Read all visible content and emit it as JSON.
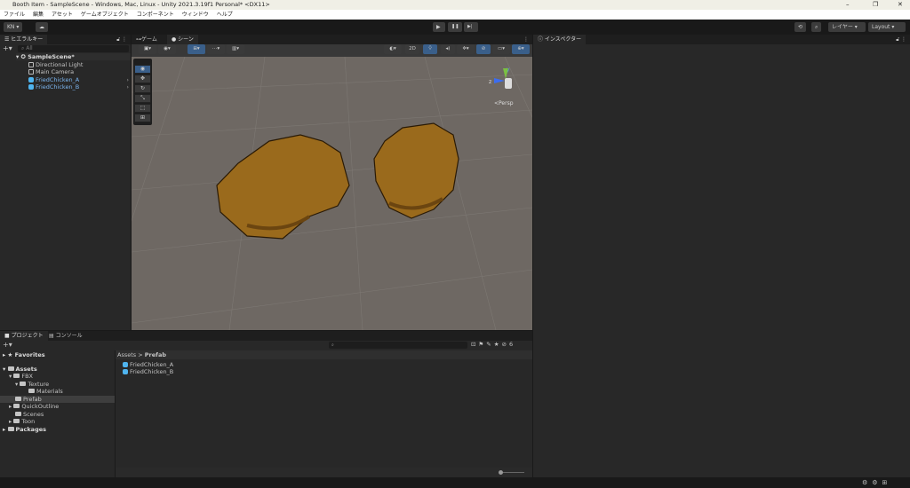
{
  "window": {
    "title": "Booth Item - SampleScene - Windows, Mac, Linux - Unity 2021.3.19f1 Personal* <DX11>",
    "minimize": "–",
    "maximize": "❐",
    "close": "✕"
  },
  "menu": [
    "ファイル",
    "編集",
    "アセット",
    "ゲームオブジェクト",
    "コンポーネント",
    "ウィンドウ",
    "ヘルプ"
  ],
  "toolbar": {
    "account": "KN ▾",
    "cloud": "☁",
    "play": "▶",
    "pause": "❚❚",
    "step": "▶|",
    "history": "⟲",
    "search": "⌕",
    "layers": "レイヤー",
    "layout": "Layout"
  },
  "hierarchy": {
    "tab": "ヒエラルキー",
    "search_placeholder": "All",
    "add": "+▾",
    "scene": "SampleScene*",
    "items": [
      {
        "label": "Directional Light",
        "prefab": false
      },
      {
        "label": "Main Camera",
        "prefab": false
      },
      {
        "label": "FriedChicken_A",
        "prefab": true
      },
      {
        "label": "FriedChicken_B",
        "prefab": true
      }
    ]
  },
  "scene_view": {
    "tabs": [
      "ゲーム",
      "シーン"
    ],
    "active_tab": "シーン",
    "mode_2d": "2D",
    "persp": "<Persp",
    "gizmo_y": "y",
    "gizmo_z": "z"
  },
  "inspector": {
    "tab": "インスペクター"
  },
  "project": {
    "tabs": [
      "プロジェクト",
      "コンソール"
    ],
    "add": "+▾",
    "favorites": "Favorites",
    "tree": [
      {
        "label": "Assets",
        "bold": true
      },
      {
        "label": "FBX"
      },
      {
        "label": "Texture"
      },
      {
        "label": "Materials"
      },
      {
        "label": "Prefab",
        "selected": true
      },
      {
        "label": "QuickOutline"
      },
      {
        "label": "Scenes"
      },
      {
        "label": "Toon"
      },
      {
        "label": "Packages",
        "bold": true
      }
    ],
    "breadcrumb": {
      "root": "Assets",
      "sep": ">",
      "current": "Prefab"
    },
    "files": [
      "FriedChicken_A",
      "FriedChicken_B"
    ],
    "hidden_count": "6"
  }
}
